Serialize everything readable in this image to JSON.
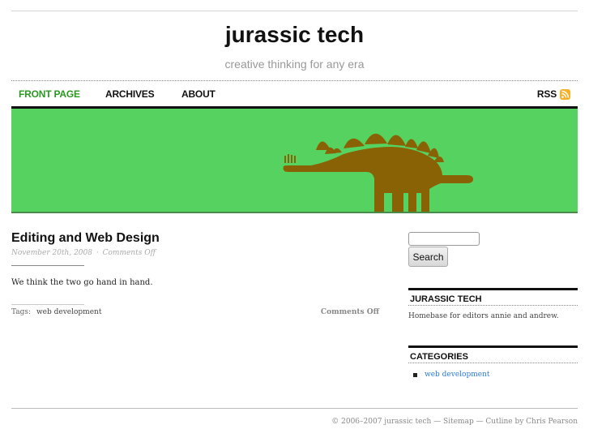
{
  "header": {
    "site_title": "jurassic tech",
    "tagline": "creative thinking for any era"
  },
  "nav": {
    "items": [
      {
        "label": "FRONT PAGE",
        "active": true
      },
      {
        "label": "ARCHIVES",
        "active": false
      },
      {
        "label": "ABOUT",
        "active": false
      }
    ],
    "rss_label": "RSS",
    "rss_icon": "rss-feed-icon"
  },
  "banner": {
    "image": "stegosaurus-silhouette",
    "background_color": "#55d25f",
    "figure_color": "#8a6206"
  },
  "post": {
    "title": "Editing and Web Design",
    "date": "November 20th, 2008",
    "meta_separator": "·",
    "comments_meta": "Comments Off",
    "body": "We think the two go hand in hand.",
    "tags_label": "Tags:",
    "tags": [
      "web development"
    ],
    "comments_footer": "Comments Off"
  },
  "sidebar": {
    "search": {
      "input_value": "",
      "button_label": "Search"
    },
    "about_widget": {
      "heading": "JURASSIC TECH",
      "text": "Homebase for editors annie and andrew."
    },
    "categories_widget": {
      "heading": "CATEGORIES",
      "items": [
        "web development"
      ]
    }
  },
  "footer": {
    "text": "© 2006–2007 jurassic tech — Sitemap — Cutline by Chris Pearson"
  },
  "colors": {
    "nav_active": "#2a9a1f",
    "link": "#2a7bd8",
    "rss": "#f7b028"
  }
}
